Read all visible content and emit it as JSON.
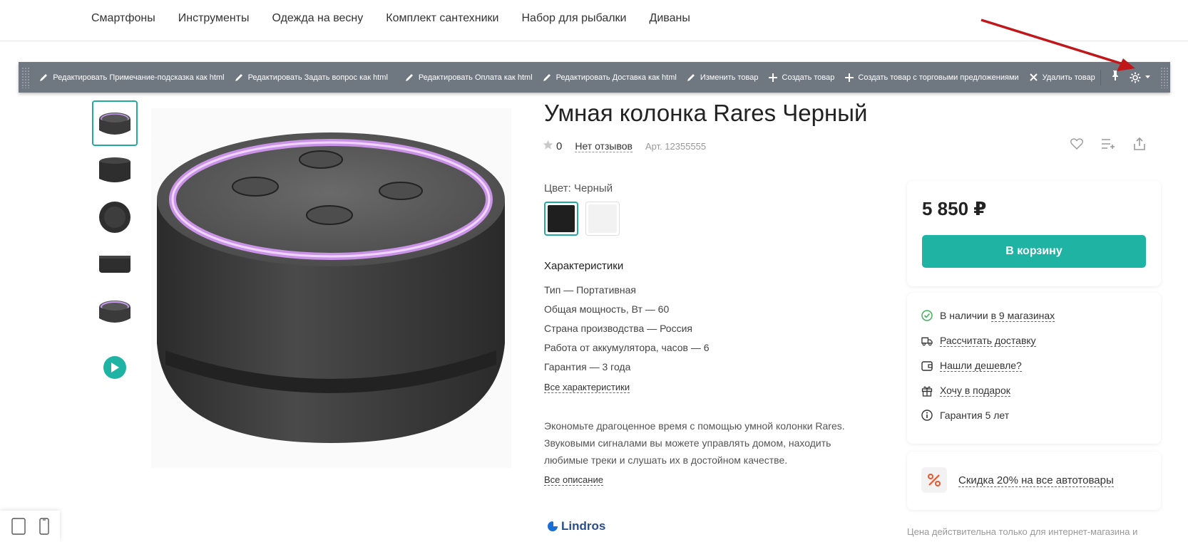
{
  "nav": {
    "items": [
      "Смартфоны",
      "Инструменты",
      "Одежда на весну",
      "Комплект сантехники",
      "Набор для рыбалки",
      "Диваны"
    ]
  },
  "admin_toolbar": {
    "buttons": [
      {
        "label": "Редактировать Примечание-подсказка как html",
        "icon": "pencil-icon"
      },
      {
        "label": "Редактировать Задать вопрос как html",
        "icon": "pencil-icon"
      },
      {
        "label": "Редактировать Оплата как html",
        "icon": "pencil-icon"
      },
      {
        "label": "Редактировать Доставка как html",
        "icon": "pencil-icon"
      },
      {
        "label": "Изменить товар",
        "icon": "pencil-icon"
      },
      {
        "label": "Создать товар",
        "icon": "plus-icon"
      },
      {
        "label": "Создать товар с торговыми предложениями",
        "icon": "plus-icon"
      },
      {
        "label": "Удалить товар",
        "icon": "close-icon"
      }
    ],
    "background": "#6f7781"
  },
  "product": {
    "title": "Умная колонка Rares Черный",
    "rating_count": "0",
    "reviews_link": "Нет отзывов",
    "sku": "Арт. 12355555",
    "color_label": "Цвет: Черный",
    "colors": [
      "#1f1f1f",
      "#f2f2f2"
    ],
    "specs_title": "Характеристики",
    "specs": [
      "Тип — Портативная",
      "Общая мощность, Вт — 60",
      "Страна производства — Россия",
      "Работа от аккумулятора, часов — 6",
      "Гарантия — 3 года"
    ],
    "all_specs_link": "Все характеристики",
    "description": "Экономьте драгоценное время с помощью умной колонки Rares. Звуковыми сигналами вы можете управлять домом, находить любимые треки и слушать их в достойном качестве.",
    "all_description_link": "Все описание",
    "brand": "Lindros"
  },
  "purchase": {
    "price": "5 850 ₽",
    "cart_button": "В корзину",
    "accent": "#1fb3a4"
  },
  "info": {
    "availability_prefix": "В наличии",
    "availability_link": "в 9 магазинах",
    "delivery_link": "Рассчитать доставку",
    "cheaper_link": "Нашли дешевле?",
    "gift_link": "Хочу в подарок",
    "warranty": "Гарантия 5 лет"
  },
  "promo": {
    "text": "Скидка 20% на все автотовары"
  },
  "note": "Цена действительна только для интернет-магазина и"
}
